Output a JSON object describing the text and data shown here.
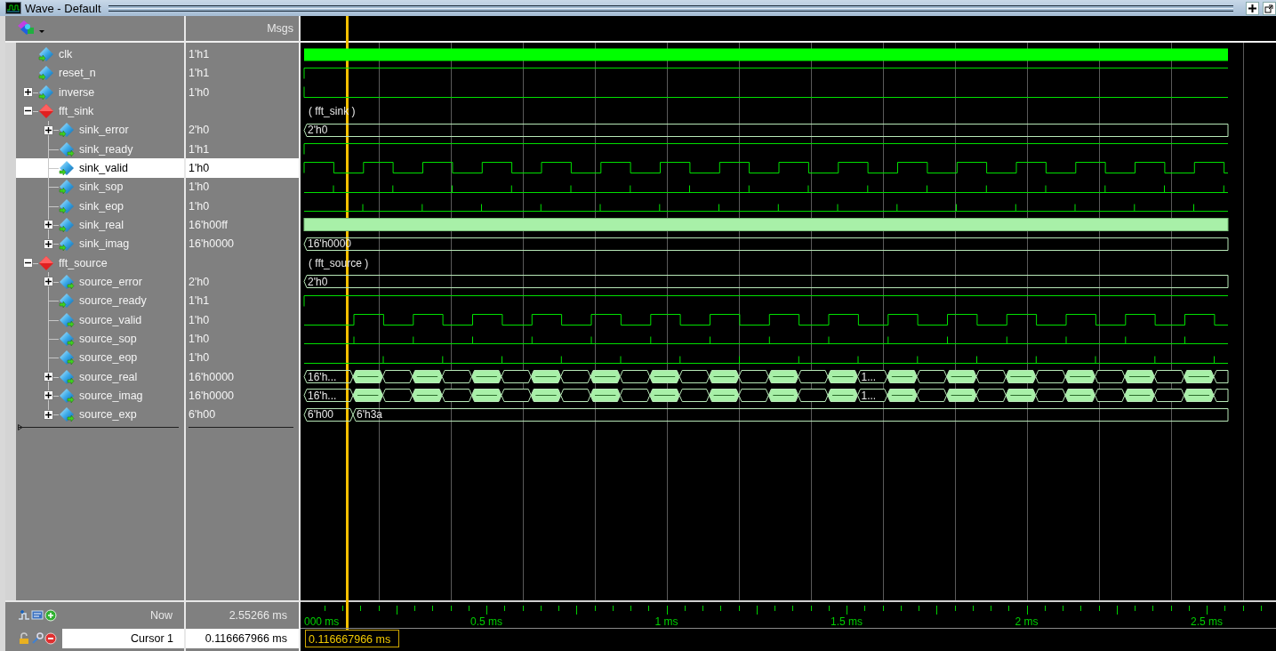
{
  "window": {
    "title": "Wave - Default"
  },
  "header": {
    "msgs_label": "Msgs"
  },
  "signals": [
    {
      "name": "clk",
      "kind": "input",
      "value": "1'h1",
      "selected": false,
      "wave": {
        "kind": "dense"
      }
    },
    {
      "name": "reset_n",
      "kind": "input",
      "value": "1'h1",
      "selected": false,
      "wave": {
        "kind": "rise"
      }
    },
    {
      "name": "inverse",
      "kind": "input",
      "expanded": false,
      "value": "1'h0",
      "selected": false,
      "wave": {
        "kind": "fall"
      }
    },
    {
      "name": "fft_sink",
      "kind": "group",
      "expanded": true,
      "selected": false,
      "wave": {
        "kind": "group",
        "label": "( fft_sink )"
      },
      "children": [
        {
          "name": "sink_error",
          "kind": "input",
          "expanded": false,
          "value": "2'h0",
          "selected": false,
          "wave": {
            "kind": "bus",
            "labels": [
              "2'h0"
            ]
          }
        },
        {
          "name": "sink_ready",
          "kind": "output",
          "value": "1'h1",
          "selected": false,
          "wave": {
            "kind": "rise"
          }
        },
        {
          "name": "sink_valid",
          "kind": "input",
          "value": "1'h0",
          "selected": true,
          "wave": {
            "kind": "pulse-sink"
          }
        },
        {
          "name": "sink_sop",
          "kind": "input",
          "value": "1'h0",
          "selected": false,
          "wave": {
            "kind": "ticks-sink-sop"
          }
        },
        {
          "name": "sink_eop",
          "kind": "input",
          "value": "1'h0",
          "selected": false,
          "wave": {
            "kind": "ticks-sink-eop"
          }
        },
        {
          "name": "sink_real",
          "kind": "input",
          "expanded": false,
          "value": "16'h00ff",
          "selected": false,
          "wave": {
            "kind": "busy-bus"
          }
        },
        {
          "name": "sink_imag",
          "kind": "input",
          "expanded": false,
          "value": "16'h0000",
          "selected": false,
          "wave": {
            "kind": "bus",
            "labels": [
              "16'h0000"
            ]
          }
        }
      ]
    },
    {
      "name": "fft_source",
      "kind": "group",
      "expanded": true,
      "selected": false,
      "wave": {
        "kind": "group",
        "label": "( fft_source )"
      },
      "children": [
        {
          "name": "source_error",
          "kind": "output",
          "expanded": false,
          "value": "2'h0",
          "selected": false,
          "wave": {
            "kind": "bus",
            "labels": [
              "2'h0"
            ]
          }
        },
        {
          "name": "source_ready",
          "kind": "input",
          "value": "1'h1",
          "selected": false,
          "wave": {
            "kind": "rise"
          }
        },
        {
          "name": "source_valid",
          "kind": "output",
          "value": "1'h0",
          "selected": false,
          "wave": {
            "kind": "pulse-source"
          }
        },
        {
          "name": "source_sop",
          "kind": "output",
          "value": "1'h0",
          "selected": false,
          "wave": {
            "kind": "ticks-source-sop"
          }
        },
        {
          "name": "source_eop",
          "kind": "output",
          "value": "1'h0",
          "selected": false,
          "wave": {
            "kind": "ticks-source-eop"
          }
        },
        {
          "name": "source_real",
          "kind": "output",
          "expanded": false,
          "value": "16'h0000",
          "selected": false,
          "wave": {
            "kind": "toggle-bus",
            "labels": [
              "16'h...",
              "1..."
            ]
          }
        },
        {
          "name": "source_imag",
          "kind": "output",
          "expanded": false,
          "value": "16'h0000",
          "selected": false,
          "wave": {
            "kind": "toggle-bus",
            "labels": [
              "16'h...",
              "1..."
            ]
          }
        },
        {
          "name": "source_exp",
          "kind": "output",
          "expanded": false,
          "value": "6'h00",
          "selected": false,
          "wave": {
            "kind": "bus",
            "labels": [
              "6'h00",
              "6'h3a"
            ]
          }
        }
      ]
    }
  ],
  "now": {
    "label": "Now",
    "value": "2.55266 ms"
  },
  "cursor": {
    "label": "Cursor 1",
    "value": "0.116667966 ms",
    "marker": "0.116667966 ms"
  },
  "ruler": {
    "labels": [
      "000 ms",
      "0.5 ms",
      "1 ms",
      "1.5 ms",
      "2 ms",
      "2.5 ms"
    ]
  }
}
